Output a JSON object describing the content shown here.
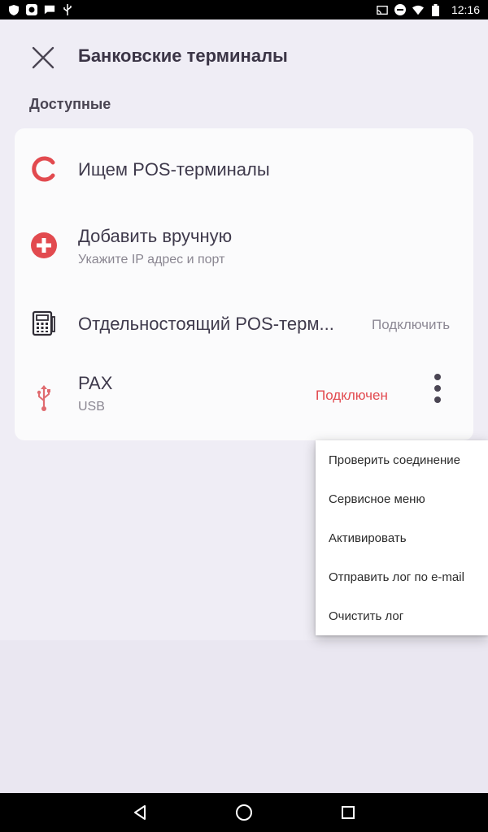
{
  "status_bar": {
    "time": "12:16",
    "left_icons": [
      "shield-icon",
      "app-notification-icon",
      "message-icon",
      "usb-icon"
    ],
    "right_icons": [
      "cast-icon",
      "do-not-disturb-icon",
      "wifi-icon",
      "battery-icon"
    ]
  },
  "header": {
    "title": "Банковские терминалы",
    "close_icon": "close-icon"
  },
  "section": {
    "label": "Доступные"
  },
  "rows": {
    "searching": {
      "title": "Ищем POS-терминалы",
      "icon": "loading-spinner-icon"
    },
    "add_manual": {
      "title": "Добавить вручную",
      "subtitle": "Укажите IP адрес и порт",
      "icon": "add-circle-icon"
    },
    "standalone": {
      "title": "Отдельностоящий POS-терм...",
      "action": "Подключить",
      "icon": "pos-terminal-icon"
    },
    "pax": {
      "title": "PAX",
      "subtitle": "USB",
      "status": "Подключен",
      "icon": "usb-icon"
    }
  },
  "menu": {
    "items": [
      "Проверить соединение",
      "Сервисное меню",
      "Активировать",
      "Отправить лог по e-mail",
      "Очистить лог"
    ]
  },
  "colors": {
    "accent_red": "#e24a4f",
    "background": "#efedf5",
    "card": "#fbfbfc"
  }
}
